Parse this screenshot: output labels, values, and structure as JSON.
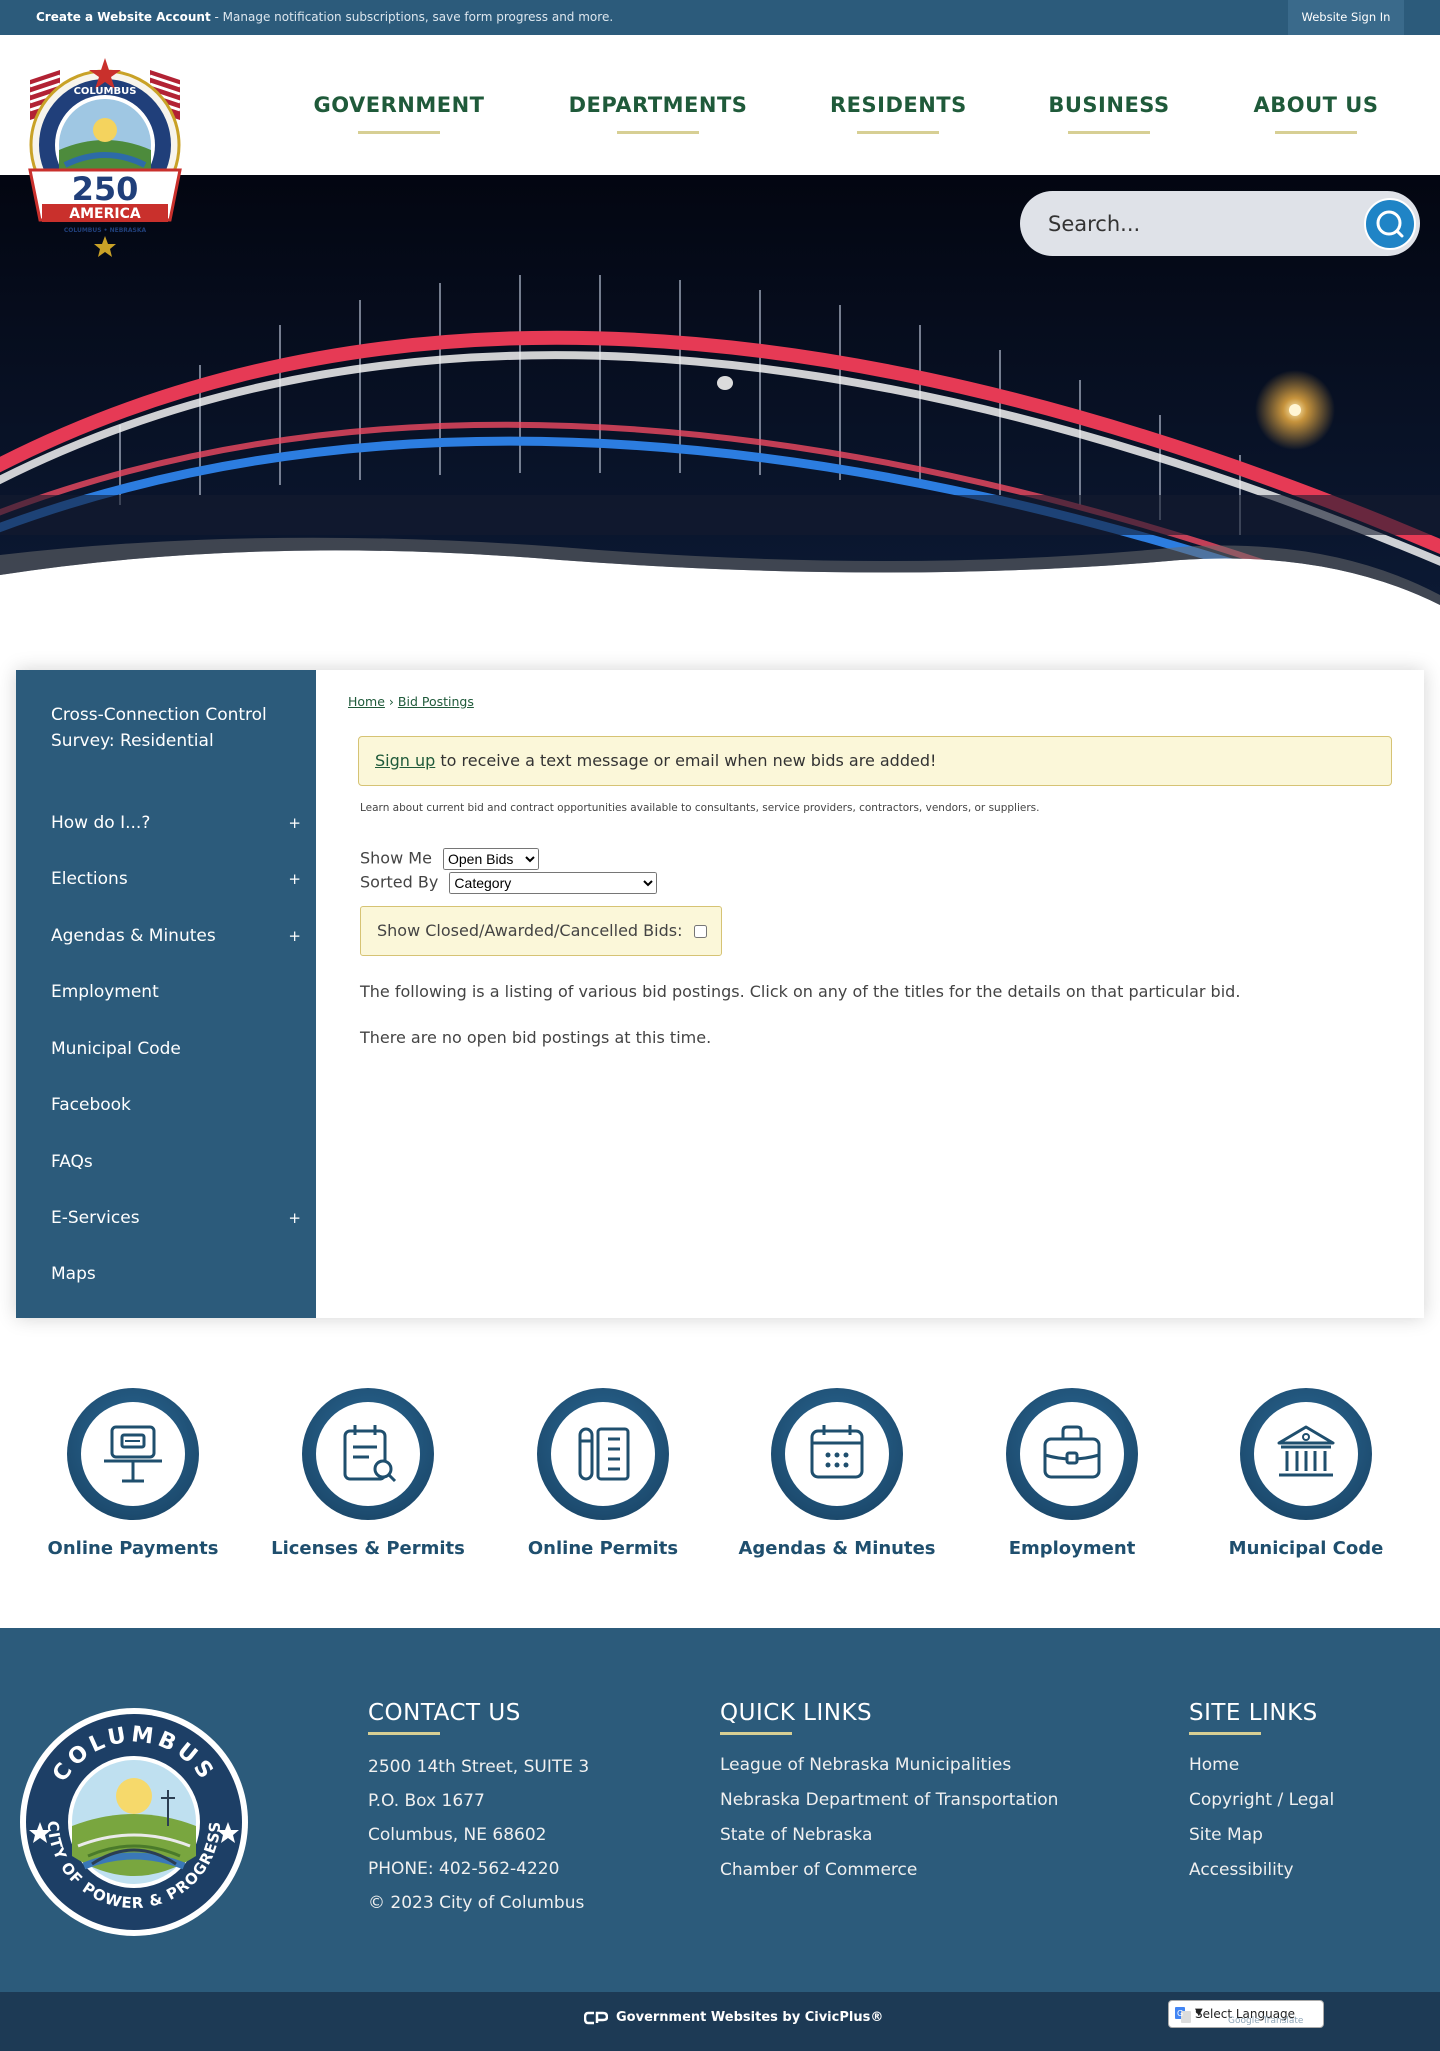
{
  "topbar": {
    "account_bold": "Create a Website Account",
    "account_desc": " - Manage notification subscriptions, save form progress and more.",
    "signin": "Website Sign In"
  },
  "nav": {
    "items": [
      "GOVERNMENT",
      "DEPARTMENTS",
      "RESIDENTS",
      "BUSINESS",
      "ABOUT US"
    ]
  },
  "logo": {
    "top_text": "COLUMBUS",
    "number": "250",
    "word": "AMERICA",
    "sub": "COLUMBUS • NEBRASKA"
  },
  "search": {
    "placeholder": "Search..."
  },
  "sidebar": {
    "items": [
      {
        "label": "Cross-Connection Control Survey: Residential",
        "expand": ""
      },
      {
        "label": "How do I...?",
        "expand": "+"
      },
      {
        "label": "Elections",
        "expand": "+"
      },
      {
        "label": "Agendas & Minutes",
        "expand": "+"
      },
      {
        "label": "Employment",
        "expand": ""
      },
      {
        "label": "Municipal Code",
        "expand": ""
      },
      {
        "label": "Facebook",
        "expand": ""
      },
      {
        "label": "FAQs",
        "expand": ""
      },
      {
        "label": "E-Services",
        "expand": "+"
      },
      {
        "label": "Maps",
        "expand": ""
      }
    ]
  },
  "content": {
    "breadcrumb": {
      "home": "Home",
      "sep": "›",
      "current": "Bid Postings"
    },
    "alert": {
      "link": "Sign up",
      "text": " to receive a text message or email when new bids are added!"
    },
    "intro": "Learn about current bid and contract opportunities available to consultants, service providers, contractors, vendors, or suppliers.",
    "show_me": {
      "label": "Show Me",
      "selected": "Open Bids"
    },
    "sorted_by": {
      "label": "Sorted By",
      "selected": "Category"
    },
    "closed_label": "Show Closed/Awarded/Cancelled Bids:",
    "listing_text": "The following is a listing of various bid postings. Click on any of the titles for the details on that particular bid.",
    "empty_text": "There are no open bid postings at this time."
  },
  "quick_links": [
    {
      "label": "Online Payments",
      "icon": "payment-kiosk-icon"
    },
    {
      "label": "Licenses & Permits",
      "icon": "license-search-icon"
    },
    {
      "label": "Online Permits",
      "icon": "permit-document-icon"
    },
    {
      "label": "Agendas & Minutes",
      "icon": "calendar-icon"
    },
    {
      "label": "Employment",
      "icon": "briefcase-icon"
    },
    {
      "label": "Municipal Code",
      "icon": "courthouse-icon"
    }
  ],
  "footer": {
    "seal": {
      "top": "COLUMBUS",
      "bottom": "CITY OF POWER & PROGRESS"
    },
    "contact": {
      "title": "CONTACT US",
      "lines": [
        "2500 14th Street, SUITE 3",
        "P.O. Box 1677",
        "Columbus, NE 68602",
        "PHONE: 402-562-4220",
        "© 2023 City of Columbus"
      ]
    },
    "quick": {
      "title": "QUICK LINKS",
      "links": [
        "League of Nebraska Municipalities",
        "Nebraska Department of Transportation",
        "State of Nebraska",
        "Chamber of Commerce"
      ]
    },
    "site": {
      "title": "SITE LINKS",
      "links": [
        "Home",
        "Copyright / Legal",
        "Site Map",
        "Accessibility"
      ]
    }
  },
  "bottom": {
    "credit": "Government Websites by CivicPlus®",
    "language": "Select Language",
    "powered": "Google Translate"
  },
  "colors": {
    "primary_blue": "#2c5b7b",
    "nav_green": "#1f5a3a",
    "accent_gold": "#d7cf94",
    "alert_bg": "#fbf7d9",
    "search_button": "#1f84c6"
  }
}
